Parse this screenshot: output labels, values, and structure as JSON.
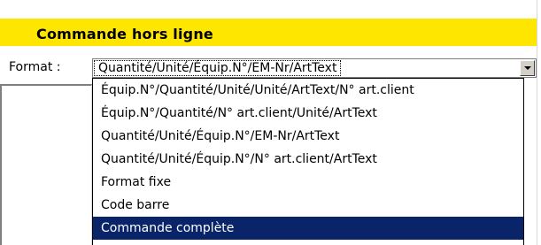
{
  "header": {
    "title": "Commande hors ligne"
  },
  "format": {
    "label": "Format :",
    "selected_value": "Quantité/Unité/Équip.N°/EM-Nr/ArtText",
    "options": [
      "Équip.N°/Quantité/Unité/Unité/ArtText/N° art.client",
      "Équip.N°/Quantité/N° art.client/Unité/ArtText",
      "Quantité/Unité/Équip.N°/EM-Nr/ArtText",
      "Quantité/Unité/Équip.N°/N° art.client/ArtText",
      "Format fixe",
      "Code barre",
      "Commande complète"
    ],
    "highlighted_option": "Commande complète"
  },
  "colors": {
    "header_background": "#ffe600",
    "selection_background": "#0a246a"
  }
}
